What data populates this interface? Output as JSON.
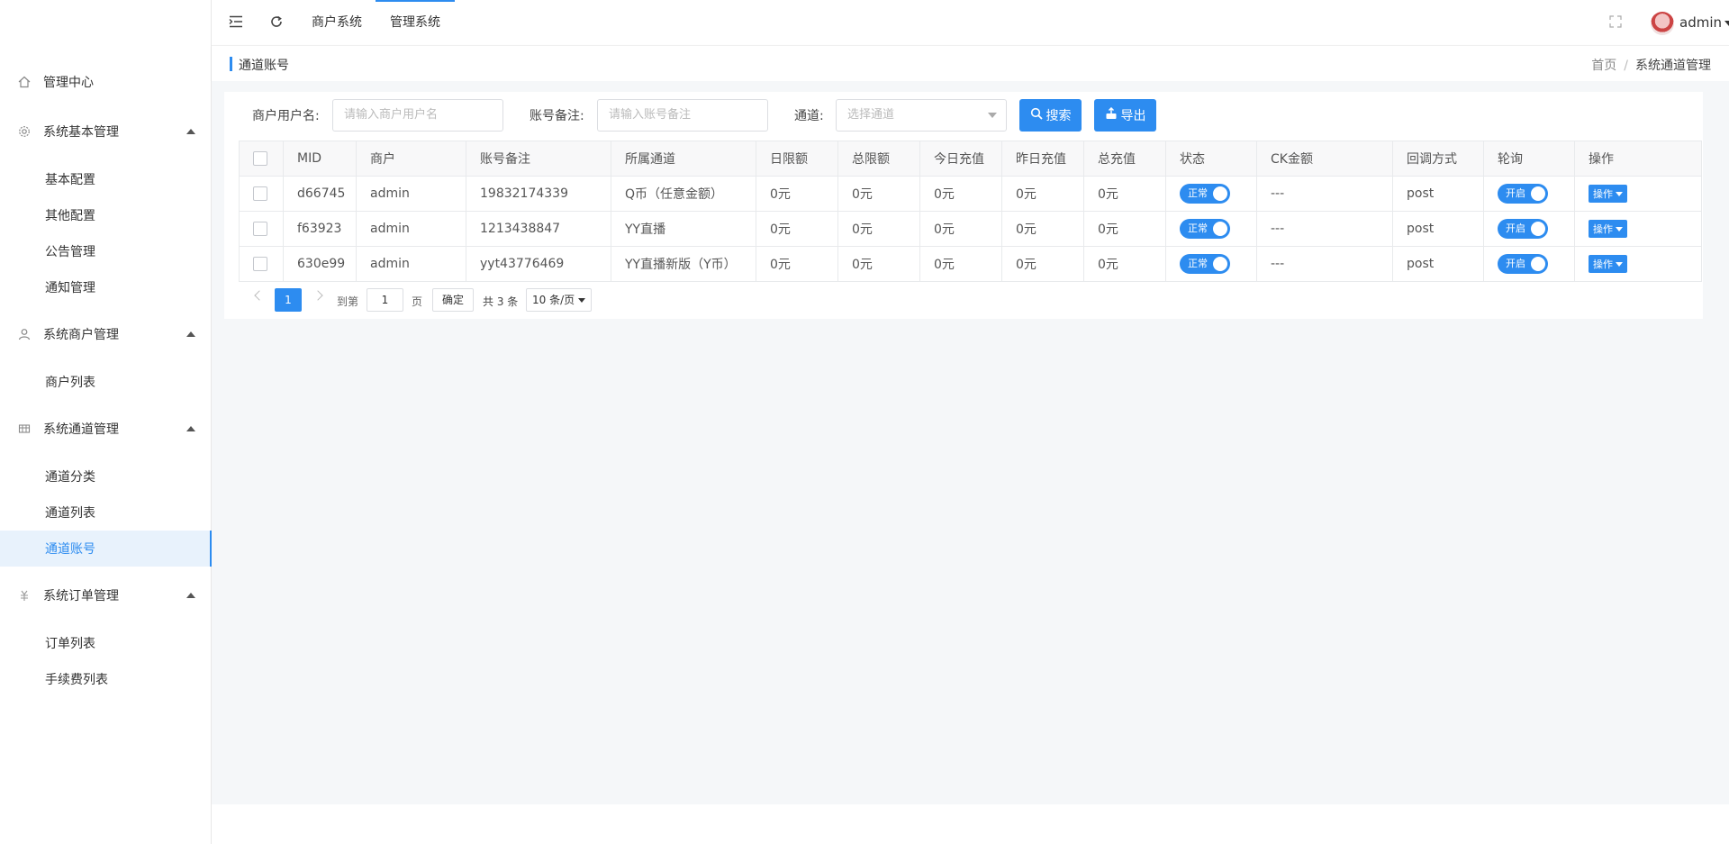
{
  "sidebar": {
    "groups": [
      {
        "label": "管理中心",
        "icon": "home-icon"
      },
      {
        "label": "系统基本管理",
        "icon": "gear-icon",
        "items": [
          "基本配置",
          "其他配置",
          "公告管理",
          "通知管理"
        ]
      },
      {
        "label": "系统商户管理",
        "icon": "user-icon",
        "items": [
          "商户列表"
        ]
      },
      {
        "label": "系统通道管理",
        "icon": "grid-icon",
        "items": [
          "通道分类",
          "通道列表",
          "通道账号"
        ]
      },
      {
        "label": "系统订单管理",
        "icon": "order-icon",
        "items": [
          "订单列表",
          "手续费列表"
        ]
      }
    ],
    "active_item": "通道账号"
  },
  "topbar": {
    "tabs": [
      "商户系统",
      "管理系统"
    ],
    "active_tab": "管理系统",
    "user": "admin"
  },
  "breadcrumb": {
    "page_title": "通道账号",
    "home": "首页",
    "sep": "/",
    "current": "系统通道管理"
  },
  "filters": {
    "merchant_label": "商户用户名:",
    "merchant_placeholder": "请输入商户用户名",
    "remark_label": "账号备注:",
    "remark_placeholder": "请输入账号备注",
    "channel_label": "通道:",
    "channel_placeholder": "选择通道",
    "search_btn": "搜索",
    "export_btn": "导出"
  },
  "table": {
    "columns": [
      "MID",
      "商户",
      "账号备注",
      "所属通道",
      "日限额",
      "总限额",
      "今日充值",
      "昨日充值",
      "总充值",
      "状态",
      "CK金额",
      "回调方式",
      "轮询",
      "操作"
    ],
    "rows": [
      {
        "mid": "d66745",
        "merchant": "admin",
        "remark": "19832174339",
        "channel": "Q币（任意金额）",
        "daily": "0元",
        "total_limit": "0元",
        "today": "0元",
        "yesterday": "0元",
        "total": "0元",
        "status": "正常",
        "ck": "---",
        "callback": "post",
        "poll": "开启",
        "op": "操作"
      },
      {
        "mid": "f63923",
        "merchant": "admin",
        "remark": "1213438847",
        "channel": "YY直播",
        "daily": "0元",
        "total_limit": "0元",
        "today": "0元",
        "yesterday": "0元",
        "total": "0元",
        "status": "正常",
        "ck": "---",
        "callback": "post",
        "poll": "开启",
        "op": "操作"
      },
      {
        "mid": "630e99",
        "merchant": "admin",
        "remark": "yyt43776469",
        "channel": "YY直播新版（Y币）",
        "daily": "0元",
        "total_limit": "0元",
        "today": "0元",
        "yesterday": "0元",
        "total": "0元",
        "status": "正常",
        "ck": "---",
        "callback": "post",
        "poll": "开启",
        "op": "操作"
      }
    ]
  },
  "pagination": {
    "current": "1",
    "goto_label": "到第",
    "page_input": "1",
    "page_unit": "页",
    "confirm": "确定",
    "total": "共 3 条",
    "page_size": "10 条/页"
  },
  "colors": {
    "accent": "#2d8cf0",
    "content_bg": "#f5f7f9"
  }
}
